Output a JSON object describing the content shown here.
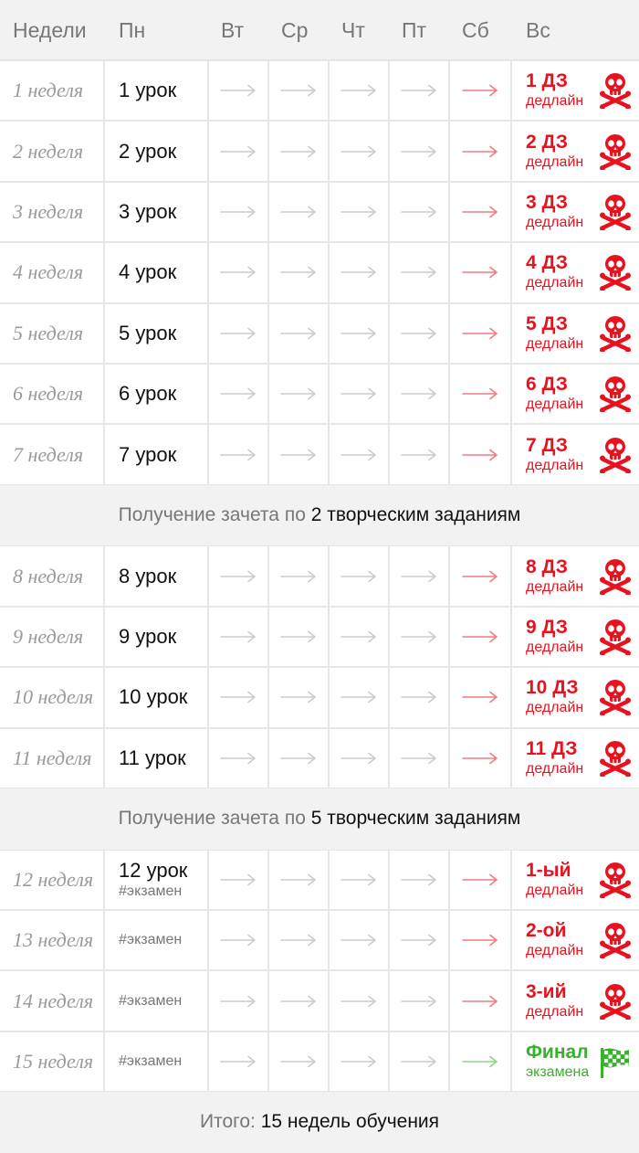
{
  "header": {
    "weeks": "Недели",
    "days": [
      "Пн",
      "Вт",
      "Ср",
      "Чт",
      "Пт",
      "Сб",
      "Вс"
    ]
  },
  "colors": {
    "red": "#e8121f",
    "green": "#37b22b",
    "arrow_gray": "#cccccc",
    "arrow_red": "#f07b80",
    "arrow_green": "#8fd48a"
  },
  "blocks": [
    {
      "weeks": [
        {
          "week": "1 неделя",
          "lesson": "1 урок",
          "tag": "",
          "deadline_title": "1 ДЗ",
          "deadline_sub": "дедлайн",
          "icon": "skull-crossbones-icon",
          "color": "red"
        },
        {
          "week": "2 неделя",
          "lesson": "2 урок",
          "tag": "",
          "deadline_title": "2 ДЗ",
          "deadline_sub": "дедлайн",
          "icon": "skull-crossbones-icon",
          "color": "red"
        },
        {
          "week": "3 неделя",
          "lesson": "3 урок",
          "tag": "",
          "deadline_title": "3 ДЗ",
          "deadline_sub": "дедлайн",
          "icon": "skull-crossbones-icon",
          "color": "red"
        },
        {
          "week": "4 неделя",
          "lesson": "4 урок",
          "tag": "",
          "deadline_title": "4 ДЗ",
          "deadline_sub": "дедлайн",
          "icon": "skull-crossbones-icon",
          "color": "red"
        },
        {
          "week": "5 неделя",
          "lesson": "5 урок",
          "tag": "",
          "deadline_title": "5 ДЗ",
          "deadline_sub": "дедлайн",
          "icon": "skull-crossbones-icon",
          "color": "red"
        },
        {
          "week": "6 неделя",
          "lesson": "6 урок",
          "tag": "",
          "deadline_title": "6 ДЗ",
          "deadline_sub": "дедлайн",
          "icon": "skull-crossbones-icon",
          "color": "red"
        },
        {
          "week": "7 неделя",
          "lesson": "7 урок",
          "tag": "",
          "deadline_title": "7 ДЗ",
          "deadline_sub": "дедлайн",
          "icon": "skull-crossbones-icon",
          "color": "red"
        }
      ],
      "banner": {
        "prefix": "Получение зачета по",
        "emphasis": "2 творческим заданиям"
      }
    },
    {
      "weeks": [
        {
          "week": "8 неделя",
          "lesson": "8 урок",
          "tag": "",
          "deadline_title": "8 ДЗ",
          "deadline_sub": "дедлайн",
          "icon": "skull-crossbones-icon",
          "color": "red"
        },
        {
          "week": "9 неделя",
          "lesson": "9 урок",
          "tag": "",
          "deadline_title": "9 ДЗ",
          "deadline_sub": "дедлайн",
          "icon": "skull-crossbones-icon",
          "color": "red"
        },
        {
          "week": "10 неделя",
          "lesson": "10 урок",
          "tag": "",
          "deadline_title": "10 ДЗ",
          "deadline_sub": "дедлайн",
          "icon": "skull-crossbones-icon",
          "color": "red"
        },
        {
          "week": "11 неделя",
          "lesson": "11 урок",
          "tag": "",
          "deadline_title": "11 ДЗ",
          "deadline_sub": "дедлайн",
          "icon": "skull-crossbones-icon",
          "color": "red"
        }
      ],
      "banner": {
        "prefix": "Получение зачета по",
        "emphasis": "5 творческим заданиям"
      }
    },
    {
      "weeks": [
        {
          "week": "12 неделя",
          "lesson": "12 урок",
          "tag": "#экзамен",
          "deadline_title": "1-ый",
          "deadline_sub": "дедлайн",
          "icon": "skull-crossbones-icon",
          "color": "red"
        },
        {
          "week": "13 неделя",
          "lesson": "",
          "tag": "#экзамен",
          "deadline_title": "2-ой",
          "deadline_sub": "дедлайн",
          "icon": "skull-crossbones-icon",
          "color": "red"
        },
        {
          "week": "14 неделя",
          "lesson": "",
          "tag": "#экзамен",
          "deadline_title": "3-ий",
          "deadline_sub": "дедлайн",
          "icon": "skull-crossbones-icon",
          "color": "red"
        },
        {
          "week": "15 неделя",
          "lesson": "",
          "tag": "#экзамен",
          "deadline_title": "Финал",
          "deadline_sub": "экзамена",
          "icon": "checkered-flag-icon",
          "color": "green"
        }
      ],
      "banner": {
        "prefix": "Итого:",
        "emphasis": "15 недель обучения"
      }
    }
  ]
}
